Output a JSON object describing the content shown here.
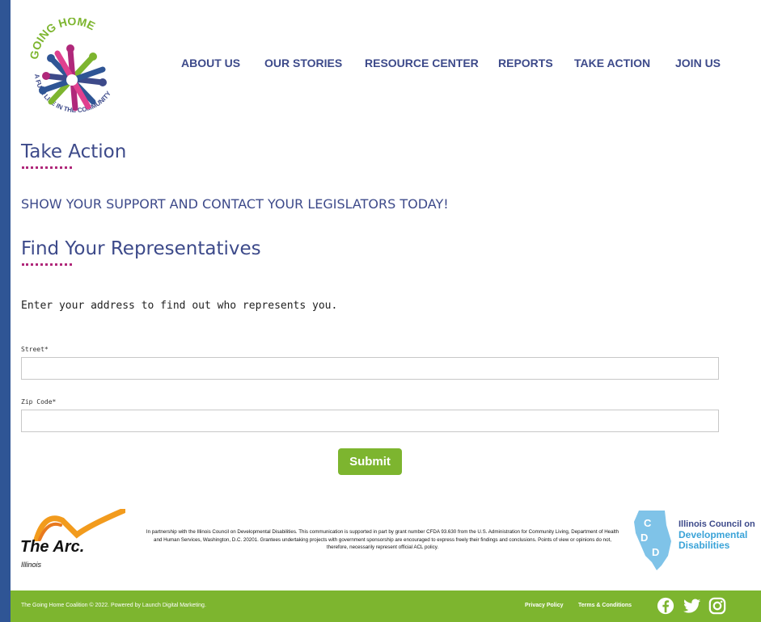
{
  "logo": {
    "top_text": "GOING HOME",
    "bottom_text": "A FULL LIFE IN THE COMMUNITY",
    "icon": "going-home-logo"
  },
  "nav": {
    "items": [
      {
        "label": "ABOUT US"
      },
      {
        "label": "OUR STORIES"
      },
      {
        "label": "RESOURCE CENTER"
      },
      {
        "label": "REPORTS"
      },
      {
        "label": "TAKE ACTION"
      },
      {
        "label": "JOIN US"
      }
    ]
  },
  "page": {
    "title": "Take Action",
    "subtitle": "SHOW YOUR SUPPORT AND CONTACT YOUR LEGISLATORS TODAY!",
    "section_title": "Find Your Representatives",
    "intro": "Enter your address to find out who represents you."
  },
  "form": {
    "street_label": "Street*",
    "street_value": "",
    "zip_label": "Zip Code*",
    "zip_value": "",
    "submit_label": "Submit"
  },
  "partners": {
    "arc_name": "The Arc.",
    "arc_sub": "Illinois",
    "disclaimer": "In partnership with the Illinois Council on Developmental Disabilities. This communication is supported in part by grant number CFDA 93.630 from the U.S. Administration for Community Living, Department of Health and Human Services, Washington, D.C. 20201. Grantees undertaking projects with government sponsorship are encouraged to express freely their findings and conclusions. Points of view or opinions do not, therefore, necessarily represent official ACL policy.",
    "icdd_line1": "Illinois Council on",
    "icdd_line2": "Developmental",
    "icdd_line3": "Disabilities",
    "icdd_letters": [
      "C",
      "D",
      "D"
    ]
  },
  "footer": {
    "copyright": "The Going Home Coalition © 2022. Powered by Launch Digital Marketing.",
    "links": [
      "Privacy Policy",
      "Terms & Conditions"
    ],
    "social": [
      "facebook-icon",
      "twitter-icon",
      "instagram-icon"
    ]
  },
  "colors": {
    "frame": "#2f5595",
    "nav_text": "#3d4a8a",
    "accent_dots": "#b0287a",
    "green": "#7db52f"
  }
}
